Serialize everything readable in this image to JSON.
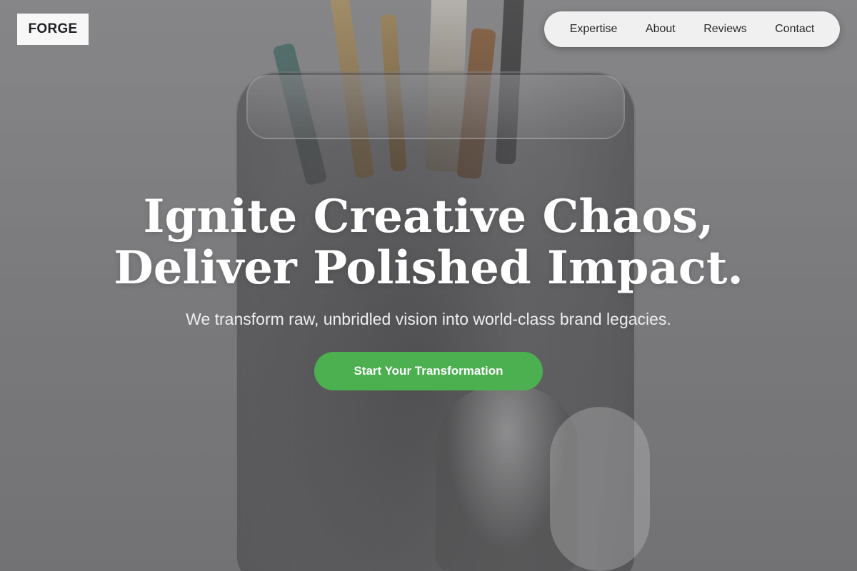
{
  "header": {
    "logo_text": "FORGE",
    "nav": [
      {
        "label": "Expertise"
      },
      {
        "label": "About"
      },
      {
        "label": "Reviews"
      },
      {
        "label": "Contact"
      }
    ]
  },
  "hero": {
    "headline_line1": "Ignite Creative Chaos,",
    "headline_line2": "Deliver Polished Impact.",
    "subtitle": "We transform raw, unbridled vision into world-class brand legacies.",
    "cta_label": "Start Your Transformation"
  },
  "colors": {
    "cta_background": "#4caf50",
    "nav_background": "#f0f0f0",
    "logo_background": "#f7f7f7",
    "headline_text": "#ffffff"
  }
}
